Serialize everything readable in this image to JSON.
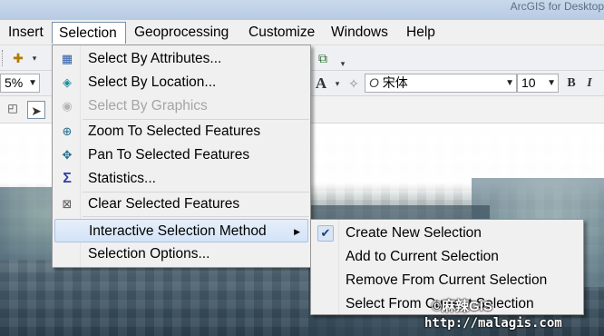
{
  "window": {
    "title": "ArcGIS for Desktop"
  },
  "menubar": {
    "items": [
      "Insert",
      "Selection",
      "Geoprocessing",
      "Customize",
      "Windows",
      "Help"
    ],
    "active": "Selection"
  },
  "toolbar": {
    "zoom_percent": "5%",
    "font_name": "宋体",
    "font_size": "10",
    "bold_label": "B",
    "italic_label": "I",
    "text_color_label": "A"
  },
  "selection_menu": {
    "items": [
      {
        "label": "Select By Attributes...",
        "icon": "table-select-icon",
        "enabled": true
      },
      {
        "label": "Select By Location...",
        "icon": "location-select-icon",
        "enabled": true
      },
      {
        "label": "Select By Graphics",
        "icon": "graphics-select-icon",
        "enabled": false
      },
      {
        "label": "Zoom To Selected Features",
        "icon": "zoom-selected-icon",
        "enabled": true
      },
      {
        "label": "Pan To Selected Features",
        "icon": "pan-selected-icon",
        "enabled": true
      },
      {
        "label": "Statistics...",
        "icon": "sigma-icon",
        "enabled": true
      },
      {
        "label": "Clear Selected Features",
        "icon": "clear-selection-icon",
        "enabled": true
      },
      {
        "label": "Interactive Selection Method",
        "icon": "",
        "enabled": true,
        "submenu": true,
        "highlighted": true
      },
      {
        "label": "Selection Options...",
        "icon": "",
        "enabled": true
      }
    ]
  },
  "interactive_submenu": {
    "items": [
      {
        "label": "Create New Selection",
        "checked": true
      },
      {
        "label": "Add to Current Selection",
        "checked": false
      },
      {
        "label": "Remove From Current Selection",
        "checked": false
      },
      {
        "label": "Select From Current Selection",
        "checked": false
      }
    ]
  },
  "watermark": {
    "line1": "©麻辣GIS",
    "line2": "http://malagis.com"
  },
  "colors": {
    "menu_bg": "#f0f0f0",
    "highlight_bg": "#d3e3f7",
    "highlight_border": "#a9c3e6",
    "disabled_text": "#a5a5a5"
  }
}
